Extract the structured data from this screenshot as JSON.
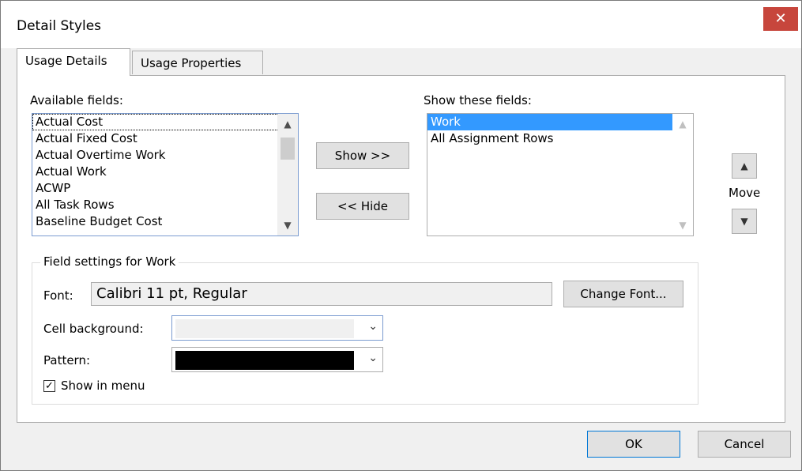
{
  "window": {
    "title": "Detail Styles",
    "close_glyph": "✕"
  },
  "tabs": [
    {
      "label": "Usage Details",
      "active": true
    },
    {
      "label": "Usage Properties",
      "active": false
    }
  ],
  "available_fields": {
    "label": "Available fields:",
    "items": [
      "Actual Cost",
      "Actual Fixed Cost",
      "Actual Overtime Work",
      "Actual Work",
      "ACWP",
      "All Task Rows",
      "Baseline Budget Cost"
    ],
    "focused_index": 0
  },
  "show_fields": {
    "label": "Show these fields:",
    "items": [
      "Work",
      "All Assignment Rows"
    ],
    "selected_index": 0
  },
  "buttons": {
    "show": "Show >>",
    "hide": "<< Hide",
    "change_font": "Change Font...",
    "ok": "OK",
    "cancel": "Cancel"
  },
  "move": {
    "label": "Move",
    "up_icon": "triangle-up-icon",
    "down_icon": "triangle-down-icon"
  },
  "field_settings": {
    "title": "Field settings for Work",
    "font_label": "Font:",
    "font_value": "Calibri 11 pt, Regular",
    "cell_background_label": "Cell background:",
    "cell_background_color": "#f0f0f0",
    "pattern_label": "Pattern:",
    "pattern_color": "#000000",
    "show_in_menu_label": "Show in menu",
    "show_in_menu_checked": true
  },
  "colors": {
    "close_button": "#c7463c",
    "selection": "#3399ff",
    "focus_border": "#0078d7"
  }
}
